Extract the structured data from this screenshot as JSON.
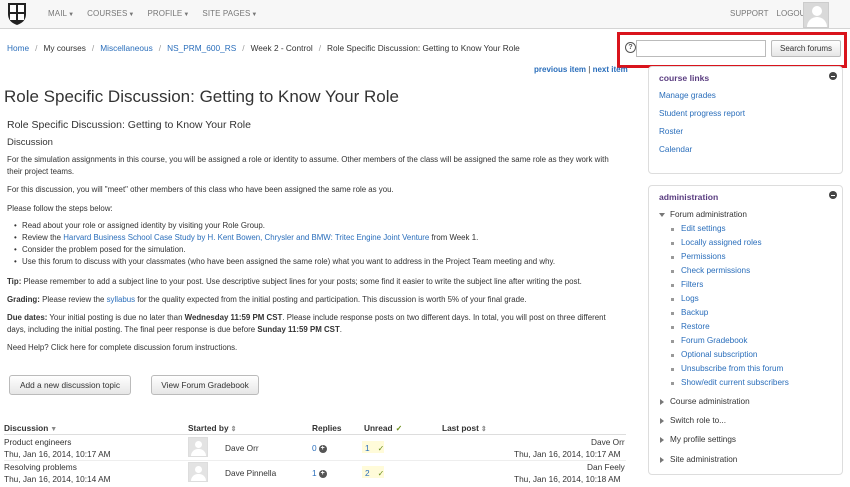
{
  "nav": {
    "menu": [
      "MAIL",
      "COURSES",
      "PROFILE",
      "SITE PAGES"
    ],
    "support": "SUPPORT",
    "logout": "LOGOUT"
  },
  "breadcrumb": {
    "home": "Home",
    "my_courses": "My courses",
    "misc": "Miscellaneous",
    "course": "NS_PRM_600_RS",
    "week": "Week 2 - Control",
    "current": "Role Specific Discussion: Getting to Know Your Role"
  },
  "search": {
    "help": "?",
    "placeholder": "",
    "button": "Search forums"
  },
  "nav_links": {
    "previous": "previous item",
    "divider": "|",
    "next": "next item"
  },
  "main": {
    "page_title": "Role Specific Discussion: Getting to Know Your Role",
    "intro_title": "Role Specific Discussion: Getting to Know Your Role",
    "discussion_heading": "Discussion",
    "p1": "For the simulation assignments in this course, you will be assigned a role or identity to assume. Other members of the class will be assigned the same role as they work with their project teams.",
    "p2": "For this discussion, you will \"meet\" other members of this class who have been assigned the same role as you.",
    "p3": "Please follow the steps below:",
    "steps": {
      "s1": "Read about your role or assigned identity by visiting your Role Group.",
      "s2_pre": "Review the ",
      "s2_link": "Harvard Business School Case Study by H. Kent Bowen, Chrysler and BMW: Tritec Engine Joint Venture",
      "s2_post": " from Week 1.",
      "s3": "Consider the problem posed for the simulation.",
      "s4": "Use this forum to discuss with your classmates (who have been assigned the same role) what you want to address in the Project Team meeting and why."
    },
    "tip_label": "Tip:",
    "tip_text": " Please remember to add a subject line to your post. Use descriptive subject lines for your posts; some find it easier to write the subject line after writing the post.",
    "grading_label": "Grading:",
    "grading_pre": " Please review the ",
    "grading_link": "syllabus",
    "grading_post": " for the quality expected from the initial posting and participation. This discussion is worth 5% of your final grade.",
    "due_label": "Due dates:",
    "due_pre": " Your initial posting is due no later than ",
    "due_bold1": "Wednesday 11:59 PM CST",
    "due_mid": ". Please include response posts on two different days. In total, you will post on three different days, including the initial posting. The final peer response is due before ",
    "due_bold2": "Sunday 11:59 PM CST",
    "due_end": ".",
    "help_link": "Need Help? Click here for complete discussion forum instructions.",
    "add_topic_button": "Add a new discussion topic",
    "gradebook_button": "View Forum Gradebook"
  },
  "table": {
    "headers": {
      "discussion": "Discussion",
      "started_by": "Started by",
      "replies": "Replies",
      "unread": "Unread",
      "last_post": "Last post"
    },
    "rows": [
      {
        "title": "Product engineers",
        "date": "Thu, Jan 16, 2014, 10:17 AM",
        "started_by": "Dave Orr",
        "replies": "0",
        "unread": "1",
        "last_user": "Dave Orr",
        "last_date": "Thu, Jan 16, 2014, 10:17 AM"
      },
      {
        "title": "Resolving problems",
        "date": "Thu, Jan 16, 2014, 10:14 AM",
        "started_by": "Dave Pinnella",
        "replies": "1",
        "unread": "2",
        "last_user": "Dan Feely",
        "last_date": "Thu, Jan 16, 2014, 10:18 AM"
      }
    ]
  },
  "course_links": {
    "title": "course links",
    "items": [
      "Manage grades",
      "Student progress report",
      "Roster",
      "Calendar"
    ]
  },
  "administration": {
    "title": "administration",
    "forum_admin": "Forum administration",
    "forum_items": [
      "Edit settings",
      "Locally assigned roles",
      "Permissions",
      "Check permissions",
      "Filters",
      "Logs",
      "Backup",
      "Restore",
      "Forum Gradebook",
      "Optional subscription",
      "Unsubscribe from this forum",
      "Show/edit current subscribers"
    ],
    "course_admin": "Course administration",
    "switch_role": "Switch role to...",
    "profile_settings": "My profile settings",
    "site_admin": "Site administration"
  },
  "colors": {
    "accent_link": "#2a6ebb",
    "block_title": "#5a3d80",
    "highlight": "#d9141c"
  }
}
